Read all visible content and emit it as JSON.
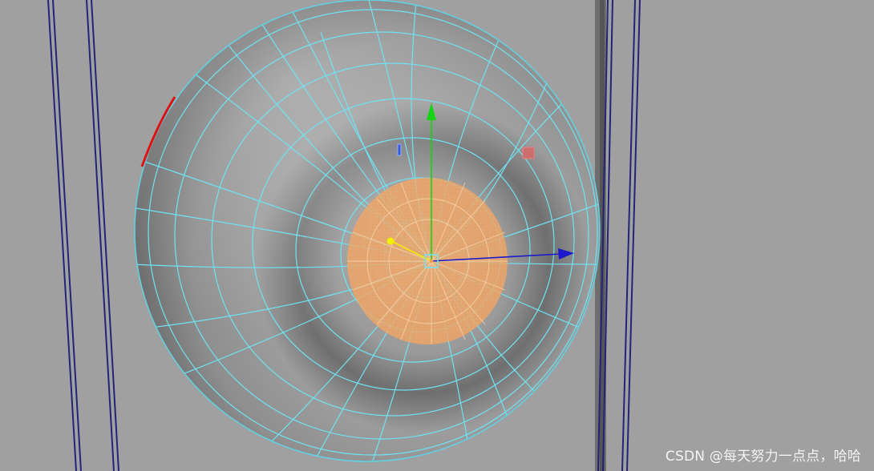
{
  "viewport": {
    "background_color": "#a0a0a0",
    "object": "sphere-mesh",
    "selection": "soft-selected-faces",
    "manipulator": "move-tool"
  },
  "colors": {
    "wireframe": "#6fe3f2",
    "soft_selection": "#f5a664",
    "axis_x": "#1a1acc",
    "axis_y": "#14d414",
    "axis_z_pivot": "#f0f000",
    "wall_edges": "#252580",
    "wall_shadow": "#4a4a4a",
    "red_edge": "#e01010"
  },
  "watermark": {
    "text": "CSDN @每天努力一点点，哈哈"
  }
}
